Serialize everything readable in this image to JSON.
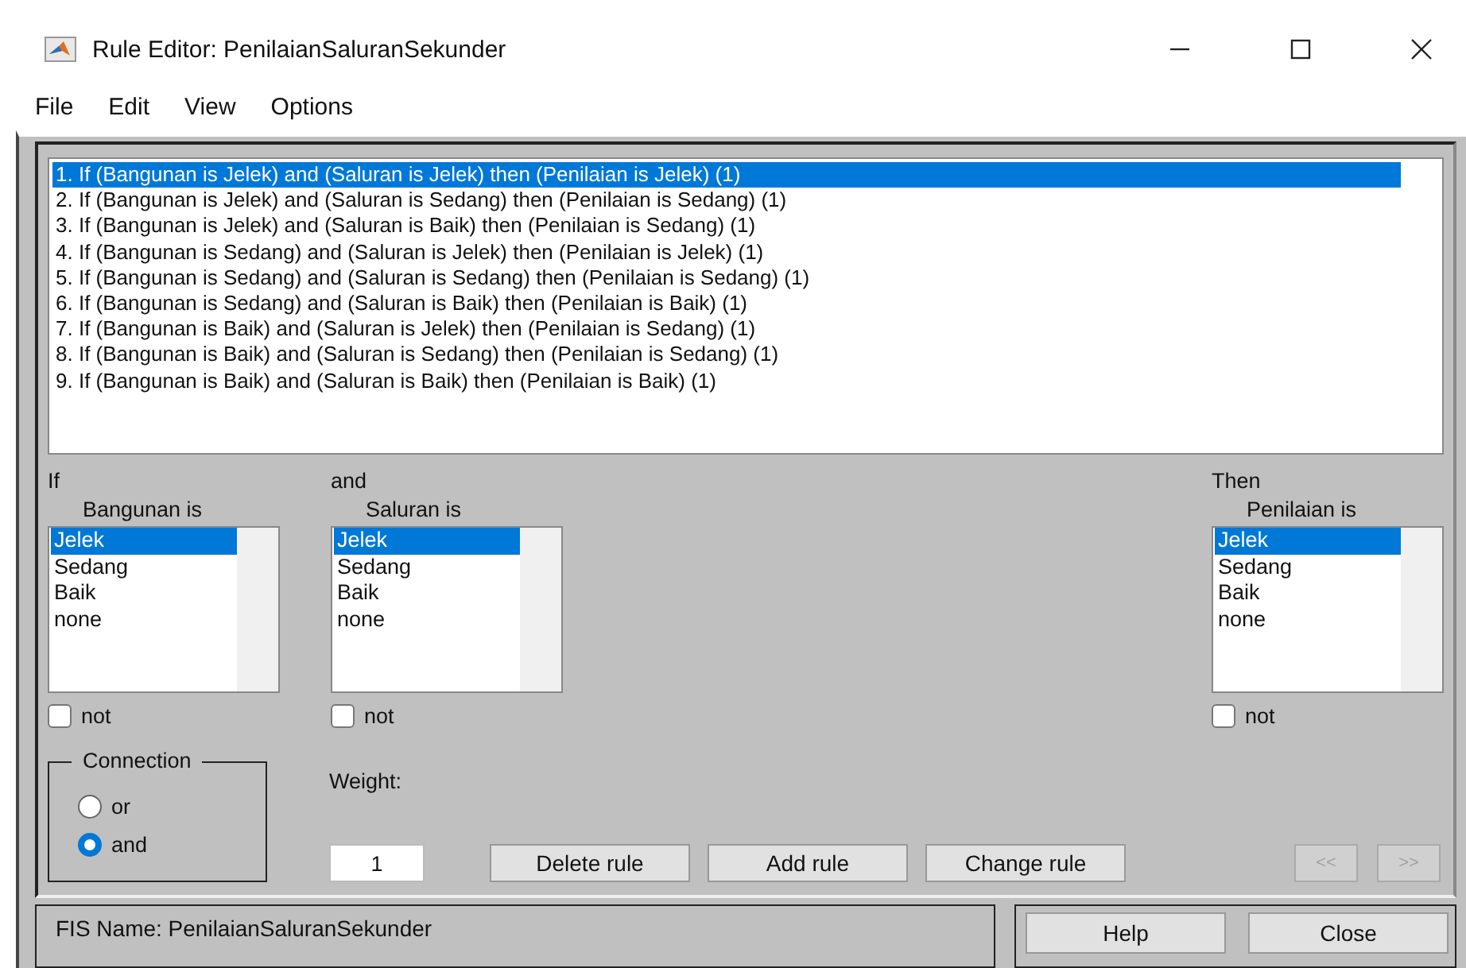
{
  "window": {
    "title": "Rule Editor: PenilaianSaluranSekunder"
  },
  "menu": [
    "File",
    "Edit",
    "View",
    "Options"
  ],
  "rules": [
    {
      "text": "1. If (Bangunan is Jelek) and (Saluran is Jelek) then (Penilaian is Jelek) (1)",
      "selected": true
    },
    {
      "text": "2. If (Bangunan is Jelek) and (Saluran is Sedang) then (Penilaian is Sedang) (1)",
      "selected": false
    },
    {
      "text": "3. If (Bangunan is Jelek) and (Saluran is Baik) then (Penilaian is Sedang) (1)",
      "selected": false
    },
    {
      "text": "4. If (Bangunan is Sedang) and (Saluran is Jelek) then (Penilaian is Jelek) (1)",
      "selected": false
    },
    {
      "text": "5. If (Bangunan is Sedang) and (Saluran is Sedang) then (Penilaian is Sedang) (1)",
      "selected": false
    },
    {
      "text": "6. If (Bangunan is Sedang) and (Saluran is Baik) then (Penilaian is Baik) (1)",
      "selected": false
    },
    {
      "text": "7. If (Bangunan is Baik) and (Saluran is Jelek) then (Penilaian is Sedang) (1)",
      "selected": false
    },
    {
      "text": "8. If (Bangunan is Baik) and (Saluran is Sedang) then (Penilaian is Sedang) (1)",
      "selected": false
    },
    {
      "text": "9. If (Bangunan is Baik) and (Saluran is Baik) then (Penilaian is Baik) (1)",
      "selected": false
    }
  ],
  "columns": [
    {
      "kind": "antecedent",
      "heading": "If",
      "label": "Bangunan is",
      "items": [
        {
          "text": "Jelek",
          "selected": true
        },
        {
          "text": "Sedang",
          "selected": false
        },
        {
          "text": "Baik",
          "selected": false
        },
        {
          "text": "none",
          "selected": false
        }
      ],
      "not": {
        "label": "not",
        "checked": false
      }
    },
    {
      "kind": "antecedent",
      "heading": "and",
      "label": "Saluran is",
      "items": [
        {
          "text": "Jelek",
          "selected": true
        },
        {
          "text": "Sedang",
          "selected": false
        },
        {
          "text": "Baik",
          "selected": false
        },
        {
          "text": "none",
          "selected": false
        }
      ],
      "not": {
        "label": "not",
        "checked": false
      }
    },
    {
      "kind": "consequent",
      "heading": "Then",
      "label": "Penilaian is",
      "items": [
        {
          "text": "Jelek",
          "selected": true
        },
        {
          "text": "Sedang",
          "selected": false
        },
        {
          "text": "Baik",
          "selected": false
        },
        {
          "text": "none",
          "selected": false
        }
      ],
      "not": {
        "label": "not",
        "checked": false
      }
    }
  ],
  "connection": {
    "title": "Connection",
    "options": [
      {
        "label": "or",
        "selected": false
      },
      {
        "label": "and",
        "selected": true
      }
    ]
  },
  "weight": {
    "label": "Weight:",
    "value": "1"
  },
  "rule_buttons": [
    {
      "label": "Delete rule",
      "disabled": false
    },
    {
      "label": "Add rule",
      "disabled": false
    },
    {
      "label": "Change rule",
      "disabled": false
    }
  ],
  "nav_buttons": [
    {
      "label": "<<",
      "disabled": true
    },
    {
      "label": ">>",
      "disabled": true
    }
  ],
  "status": "FIS Name: PenilaianSaluranSekunder",
  "footer_buttons": [
    {
      "label": "Help"
    },
    {
      "label": "Close"
    }
  ]
}
